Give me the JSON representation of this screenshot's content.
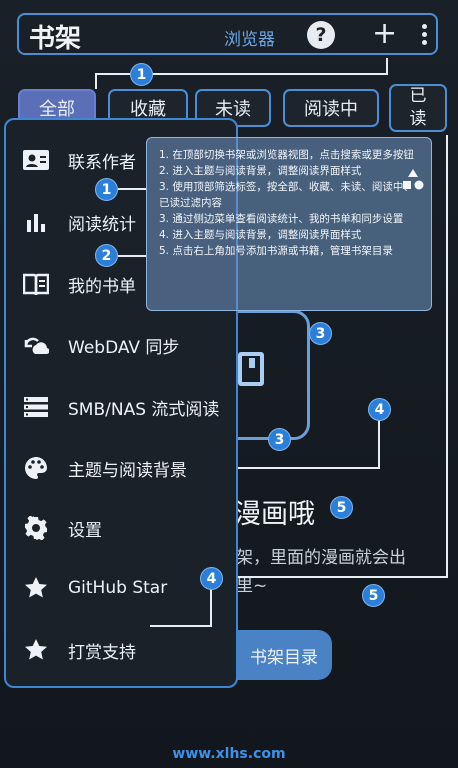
{
  "topbar": {
    "title": "书架",
    "browser_label": "浏览器",
    "help_symbol": "?",
    "add_symbol": "+"
  },
  "tabs": [
    {
      "label": "全部",
      "active": true
    },
    {
      "label": "收藏",
      "active": false
    },
    {
      "label": "未读",
      "active": false
    },
    {
      "label": "阅读中",
      "active": false
    },
    {
      "label_line1": "已",
      "label_line2": "读",
      "active": false
    }
  ],
  "drawer": {
    "items": [
      {
        "label": "联系作者",
        "icon": "contact-card-icon"
      },
      {
        "label": "阅读统计",
        "icon": "bar-chart-icon"
      },
      {
        "label": "我的书单",
        "icon": "book-open-icon"
      },
      {
        "label": "WebDAV 同步",
        "icon": "cloud-sync-icon"
      },
      {
        "label": "SMB/NAS 流式阅读",
        "icon": "storage-icon"
      },
      {
        "label": "主题与阅读背景",
        "icon": "palette-icon"
      },
      {
        "label": "设置",
        "icon": "gear-icon"
      },
      {
        "label": "GitHub Star",
        "icon": "star-icon"
      },
      {
        "label": "打赏支持",
        "icon": "star-icon"
      }
    ]
  },
  "tips": [
    "1. 在顶部切换书架或浏览器视图，点击搜索或更多按钮",
    "2. 进入主题与阅读背景，调整阅读界面样式",
    "3. 使用顶部筛选标签，按全部、收藏、未读、阅读中、已读过滤内容",
    "3. 通过侧边菜单查看阅读统计、我的书单和同步设置",
    "4. 进入主题与阅读背景，调整阅读界面样式",
    "5. 点击右上角加号添加书源或书籍，管理书架目录"
  ],
  "background": {
    "empty_title": "漫画哦",
    "empty_desc_line1": "架，里面的漫画就会出",
    "empty_desc_line2": "里~",
    "cta_label": "书架目录"
  },
  "badges": {
    "b1": "1",
    "b2": "2",
    "b3": "3",
    "b4": "4",
    "b5": "5"
  },
  "footer": {
    "url": "www.xlhs.com"
  },
  "colors": {
    "accent": "#4a8fd6",
    "badge": "#2b7fd8",
    "active_tab": "#5a6fb8"
  }
}
